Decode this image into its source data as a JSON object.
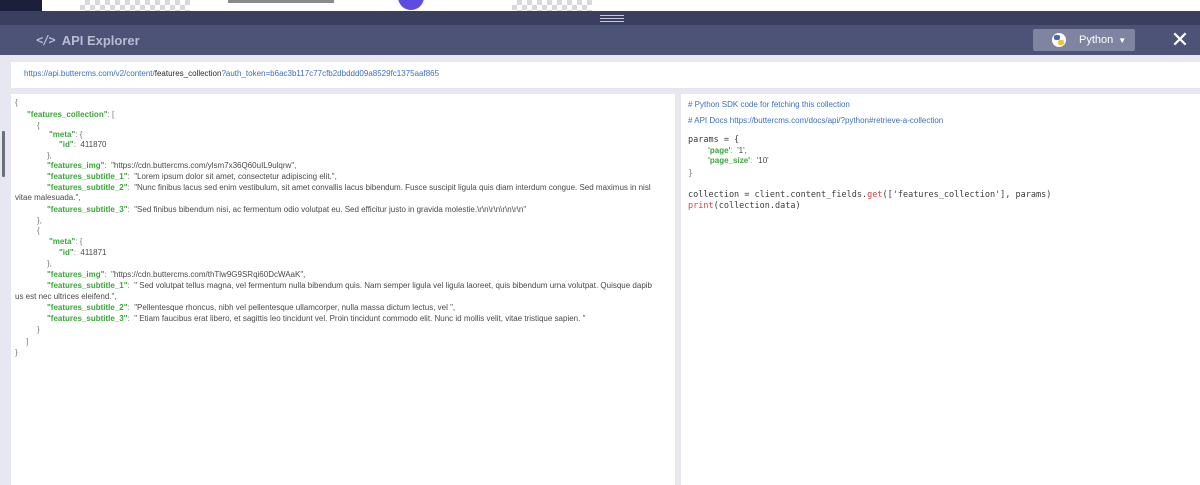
{
  "header": {
    "title": "API Explorer",
    "language": "Python"
  },
  "url": {
    "base": "https://api.buttercms.com/v2/content/",
    "collection": "features_collection",
    "query": "?auth_token=b6ac3b117c77cfb2dbddd09a8529fc1375aaf865"
  },
  "json": {
    "root_key": "\"features_collection\"",
    "meta_key": "\"meta\"",
    "id_key": "\"id\"",
    "img_key": "\"features_img\"",
    "sub1_key": "\"features_subtitle_1\"",
    "sub2_key": "\"features_subtitle_2\"",
    "sub3_key": "\"features_subtitle_3\"",
    "items": [
      {
        "id": "411870",
        "img": "\"https://cdn.buttercms.com/ylsm7x36Q60uIL9ulqrw\",",
        "subtitle_1": "\"Lorem ipsum dolor sit amet, consectetur adipiscing elit.\",",
        "subtitle_2_a": "\"Nunc finibus lacus sed enim vestibulum, sit amet convallis lacus bibendum. Fusce suscipit ligula quis diam interdum congue. Sed maximus in nisl",
        "subtitle_2_b": "vitae malesuada.\",",
        "subtitle_3": "\"Sed finibus bibendum nisi, ac fermentum odio volutpat eu. Sed efficitur justo in gravida molestie.\\r\\n\\r\\n\\r\\n\\r\\n\""
      },
      {
        "id": "411871",
        "img": "\"https://cdn.buttercms.com/thTlw9G9SRqi60DcWAaK\",",
        "subtitle_1_a": "\" Sed volutpat tellus magna, vel fermentum nulla bibendum quis. Nam semper ligula vel ligula laoreet, quis bibendum urna volutpat. Quisque dapib",
        "subtitle_1_b": "us est nec ultrices eleifend.\",",
        "subtitle_2": "\"Pellentesque rhoncus, nibh vel pellentesque ullamcorper, nulla massa dictum lectus, vel \",",
        "subtitle_3": "\" Etiam faucibus erat libero, et sagittis leo tincidunt vel. Proin tincidunt commodo elit. Nunc id mollis velit, vitae tristique sapien. \""
      }
    ]
  },
  "sdk": {
    "comment_1": "# Python SDK code for fetching this collection",
    "comment_2": "# API Docs https://buttercms.com/docs/api/?python#retrieve-a-collection",
    "params_decl": "params = {",
    "page_key": "'page'",
    "page_val": "'1',",
    "page_size_key": "'page_size'",
    "page_size_val": "'10'",
    "close_brace": "}",
    "line_collection_a": "collection = client.content_fields.",
    "line_collection_fn": "get",
    "line_collection_b": "(['features_collection'], params)",
    "line_print_fn": "print",
    "line_print_b": "(collection.data)"
  }
}
